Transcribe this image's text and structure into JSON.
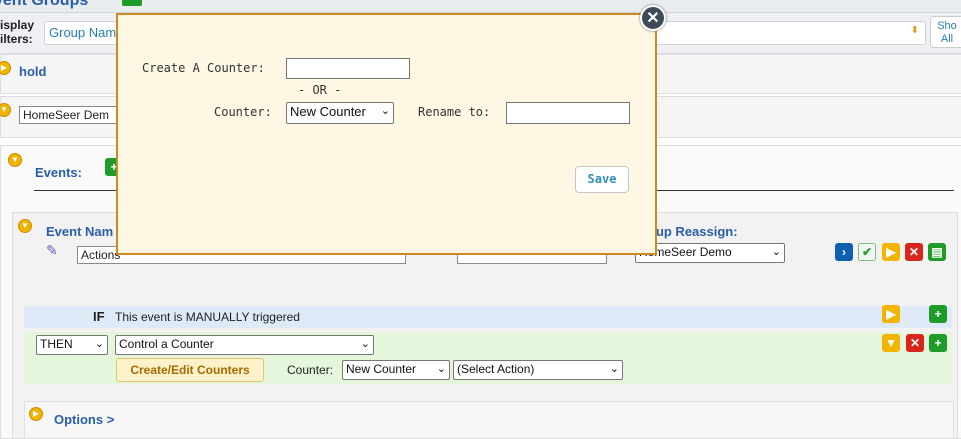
{
  "header": {
    "title": "vent Groups"
  },
  "filters": {
    "label_line1": "isplay",
    "label_line2": "ilters:",
    "select_value": "Group Nam",
    "show_all_line1": "Sho",
    "show_all_line2": "All"
  },
  "group": {
    "hold_label": "hold",
    "group_name_value": "HomeSeer Dem",
    "events_label": "Events:"
  },
  "event": {
    "name_label": "Event Nam",
    "name_value": "Actions",
    "group_reassign_label": "oup Reassign:",
    "group_reassign_value": "HomeSeer Demo"
  },
  "if_row": {
    "keyword": "IF",
    "text": "This event is MANUALLY triggered"
  },
  "then_row": {
    "then_value": "THEN",
    "action_value": "Control a Counter",
    "create_edit_label": "Create/Edit Counters",
    "counter_label": "Counter:",
    "counter_value": "New Counter",
    "select_action_value": "(Select Action)"
  },
  "options": {
    "label": "Options >"
  },
  "modal": {
    "create_label": "Create A Counter:",
    "or_label": "- OR -",
    "counter_label": "Counter:",
    "counter_value": "New Counter",
    "rename_label": "Rename to:",
    "save_label": "Save",
    "close_glyph": "✕"
  },
  "colors": {
    "modal_bg": "#fdf7e3",
    "modal_border": "#cc8a22",
    "if_band": "#dfeaf8",
    "then_band": "#e5f6dd",
    "label_blue": "#2a5ea8"
  }
}
